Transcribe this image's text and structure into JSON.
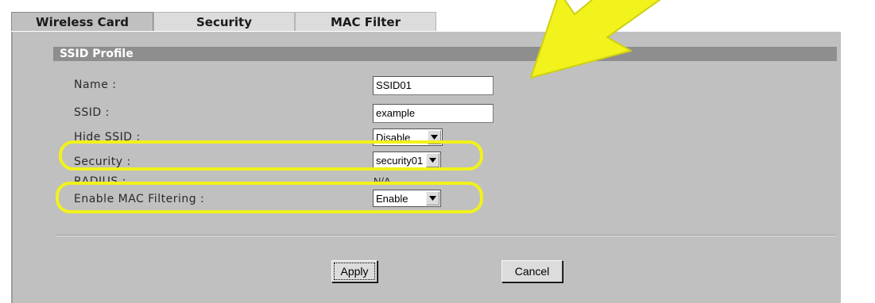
{
  "tabs": [
    {
      "label": "Wireless Card",
      "active": true
    },
    {
      "label": "Security",
      "active": false
    },
    {
      "label": "MAC Filter",
      "active": false
    }
  ],
  "section": {
    "title": "SSID Profile"
  },
  "fields": {
    "name": {
      "label": "Name :",
      "value": "SSID01"
    },
    "ssid": {
      "label": "SSID :",
      "value": "example"
    },
    "hide_ssid": {
      "label": "Hide SSID :",
      "value": "Disable"
    },
    "security": {
      "label": "Security :",
      "value": "security01"
    },
    "radius": {
      "label": "RADIUS :",
      "value": "N/A"
    },
    "mac_filtering": {
      "label": "Enable MAC Filtering :",
      "value": "Enable"
    }
  },
  "buttons": {
    "apply": "Apply",
    "cancel": "Cancel"
  },
  "colors": {
    "panel": "#c0c0c0",
    "header": "#8e8e8e",
    "highlight": "#f2f21c"
  },
  "icons": {
    "dropdown": "dropdown-arrow-icon",
    "pointer": "yellow-arrow-annotation"
  }
}
